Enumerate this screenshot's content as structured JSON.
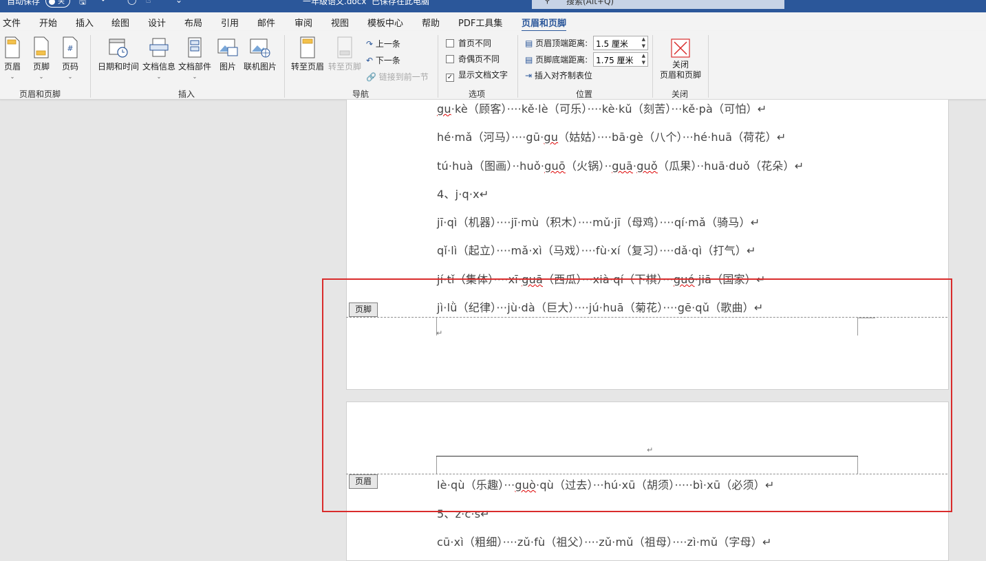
{
  "titlebar": {
    "autosave": "自动保存",
    "toggle_state": "关",
    "doc_name": "一年级语文.docx",
    "save_status": "已保存在此电脑",
    "search_placeholder": "搜索(Alt+Q)"
  },
  "tabs": [
    "文件",
    "开始",
    "插入",
    "绘图",
    "设计",
    "布局",
    "引用",
    "邮件",
    "审阅",
    "视图",
    "模板中心",
    "帮助",
    "PDF工具集",
    "页眉和页脚"
  ],
  "active_tab": "页眉和页脚",
  "ribbon": {
    "group1": {
      "label": "页眉和页脚",
      "header": "页眉",
      "footer": "页脚",
      "page_number": "页码"
    },
    "group2": {
      "label": "插入",
      "datetime": "日期和时间",
      "docinfo": "文档信息",
      "docparts": "文档部件",
      "picture": "图片",
      "online_picture": "联机图片"
    },
    "group3": {
      "label": "导航",
      "goto_header": "转至页眉",
      "goto_footer": "转至页脚",
      "previous": "上一条",
      "next": "下一条",
      "link_previous": "链接到前一节"
    },
    "group4": {
      "label": "选项",
      "diff_first": "首页不同",
      "diff_odd_even": "奇偶页不同",
      "show_doc_text": "显示文档文字",
      "show_doc_text_checked": true
    },
    "group5": {
      "label": "位置",
      "header_top": "页眉顶端距离:",
      "header_top_value": "1.5 厘米",
      "footer_bottom": "页脚底端距离:",
      "footer_bottom_value": "1.75 厘米",
      "insert_tab": "插入对齐制表位"
    },
    "group6": {
      "label": "关闭",
      "close_line1": "关闭",
      "close_line2": "页眉和页脚"
    }
  },
  "document": {
    "footer_tag": "页脚",
    "header_tag": "页眉",
    "para_mark": "↵",
    "line1": [
      "gu",
      "·kè（顾客）····kě·lè（可乐）····kè·kǔ（刻苦）···kě·pà（可怕）↵"
    ],
    "line2": [
      "hé·mǎ（河马）····gū·",
      "gu",
      "（姑姑）····bā·gè（八个）···hé·huā（荷花）↵"
    ],
    "line3": [
      "tú·huà（图画）··huǒ·",
      "guō",
      "（火锅）··",
      "guā",
      "·",
      "guǒ",
      "（瓜果）··huā·duǒ（花朵）↵"
    ],
    "line4": "4、j·q·x↵",
    "line5": "jī·qì（机器）····jī·mù（积木）····mǔ·jī（母鸡）····qí·mǎ（骑马）↵",
    "line6": "qǐ·lì（起立）····mǎ·xì（马戏）····fù·xí（复习）····dǎ·qì（打气）↵",
    "line7": [
      "jí·tǐ（集体）····xī·",
      "guā",
      "（西瓜）···xià·qí（下棋）···",
      "guó",
      "·jiā（国家）↵"
    ],
    "line8": "jì·lǜ（纪律）···jù·dà（巨大）····jú·huā（菊花）····gē·qǔ（歌曲）↵",
    "line9": [
      "lè·qù（乐趣）···",
      "guò",
      "·qù（过去）···hú·xū（胡须）·····bì·xū（必须）↵"
    ],
    "line10": "5、z·c·s↵",
    "line11": "cū·xì（粗细）····zǔ·fù（祖父）····zǔ·mǔ（祖母）····zì·mǔ（字母）↵"
  }
}
